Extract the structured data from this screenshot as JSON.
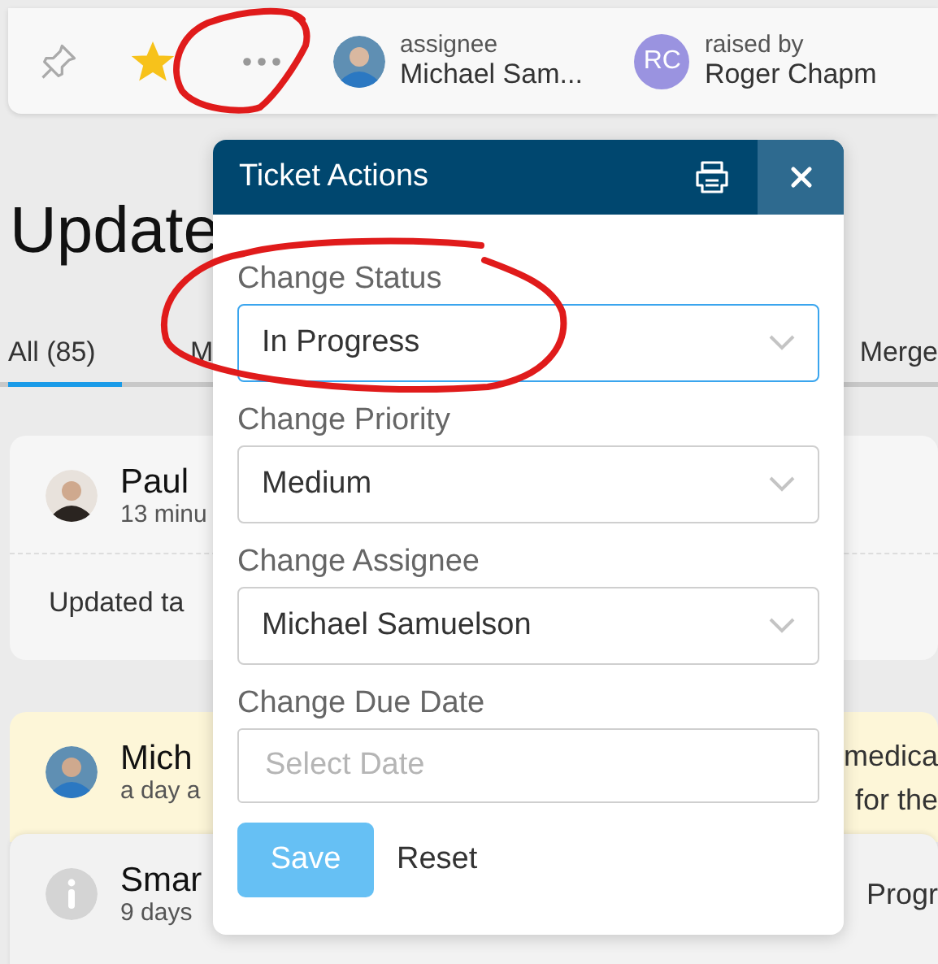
{
  "toolbar": {
    "pinned": false,
    "starred": true,
    "assignee": {
      "label": "assignee",
      "name": "Michael Sam..."
    },
    "raised_by": {
      "label": "raised by",
      "initials": "RC",
      "name": "Roger Chapm"
    }
  },
  "heading": "Update",
  "tabs": [
    {
      "label": "All (85)",
      "selected": true
    },
    {
      "label": "M",
      "selected": false
    },
    {
      "label": "Merge",
      "selected": false
    }
  ],
  "feed": [
    {
      "kind": "avatar",
      "name": "Paul",
      "time": "13 minu",
      "body": "Updated ta",
      "highlighted": false
    },
    {
      "kind": "avatar",
      "name": "Mich",
      "time": "a day a",
      "side": [
        "medica",
        "for the"
      ],
      "highlighted": true
    },
    {
      "kind": "info",
      "name": "Smar",
      "time": "9 days",
      "side": [
        "Progr"
      ],
      "highlighted": false
    }
  ],
  "dialog": {
    "title": "Ticket Actions",
    "fields": [
      {
        "kind": "select",
        "label": "Change Status",
        "value": "In Progress",
        "focused": true
      },
      {
        "kind": "select",
        "label": "Change Priority",
        "value": "Medium",
        "focused": false
      },
      {
        "kind": "select",
        "label": "Change Assignee",
        "value": "Michael Samuelson",
        "focused": false
      },
      {
        "kind": "date",
        "label": "Change Due Date",
        "placeholder": "Select Date",
        "focused": false
      }
    ],
    "save": {
      "label": "Save",
      "disabled": true
    },
    "reset": "Reset"
  }
}
